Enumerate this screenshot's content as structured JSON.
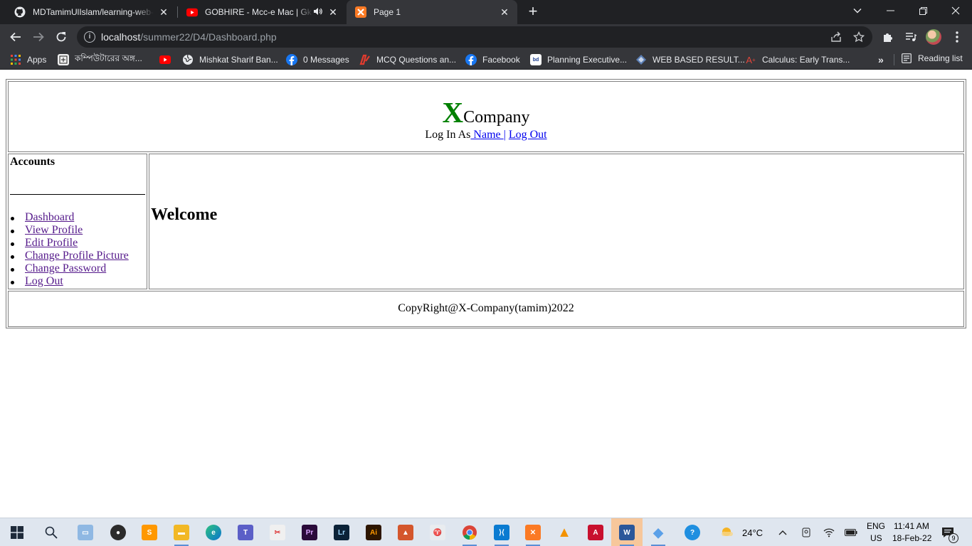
{
  "browser": {
    "tabs": [
      {
        "title": "MDTamimUlIslam/learning-web-t",
        "icon": "github-icon",
        "active": false
      },
      {
        "title": "GOBHIRE - Mcc-e Mac | Gk Kaise",
        "icon": "youtube-icon",
        "active": false
      },
      {
        "title": "Page 1",
        "icon": "xampp-icon",
        "active": true
      }
    ],
    "url_host": "localhost",
    "url_path": "/summer22/D4/Dashboard.php",
    "bookmarks": [
      {
        "label": "Apps",
        "icon": "apps-grid-icon"
      },
      {
        "label": "কম্পিউটারের অঙ্গ...",
        "icon": "bookmark-page-icon"
      },
      {
        "label": "",
        "icon": "youtube-icon"
      },
      {
        "label": "Mishkat Sharif Ban...",
        "icon": "globe-icon"
      },
      {
        "label": "0 Messages",
        "icon": "facebook-icon"
      },
      {
        "label": "MCQ Questions an...",
        "icon": "mcq-icon"
      },
      {
        "label": "Facebook",
        "icon": "facebook-icon"
      },
      {
        "label": "Planning Executive...",
        "icon": "bdjobs-icon"
      },
      {
        "label": "WEB BASED RESULT...",
        "icon": "diamond-icon"
      },
      {
        "label": "Calculus: Early Trans...",
        "icon": "a-plus-icon"
      }
    ],
    "reading_list": "Reading list"
  },
  "page": {
    "logo_x": "X",
    "logo_rest": "Company",
    "login_prefix": "Log In As",
    "login_name": " Name ",
    "login_sep": "|",
    "logout": "Log Out",
    "sidebar_title": "Accounts",
    "menu": [
      "Dashboard",
      "View Profile",
      "Edit Profile",
      "Change Profile Picture",
      "Change Password",
      "Log Out"
    ],
    "welcome": "Welcome",
    "copyright": "CopyRight@X-Company(tamim)2022"
  },
  "taskbar": {
    "weather": "24°C",
    "lang_top": "ENG",
    "lang_bottom": "US",
    "time": "11:41 AM",
    "date": "18-Feb-22",
    "notifications": "9"
  },
  "colors": {
    "tab_strip": "#202124",
    "toolbar": "#35363a",
    "logo_x": "#008000",
    "link": "#0000ee",
    "visited_link": "#551a8b",
    "taskbar": "#dfe6ef"
  }
}
